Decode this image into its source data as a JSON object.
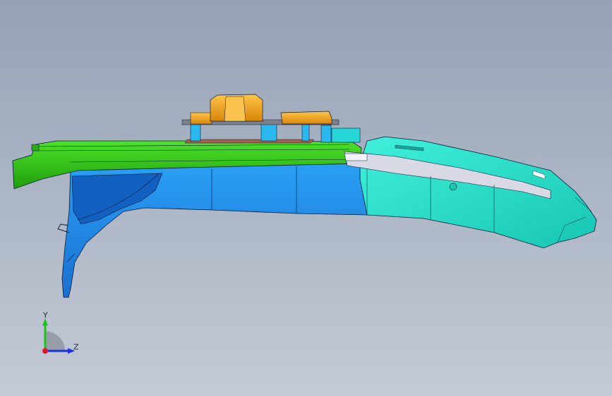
{
  "viewport": {
    "background_top": "#95a2b4",
    "background_bottom": "#c4cad6"
  },
  "model": {
    "colors": {
      "green_panel": "#2ecb12",
      "blue_body": "#1f86e6",
      "cyan_cover": "#27e8cf",
      "orange_blocks": "#f5a516",
      "edge": "#0b1a3a"
    }
  },
  "triad": {
    "y_label": "Y",
    "z_label": "Z",
    "x_color": "#e0142a",
    "y_color": "#1bc21b",
    "z_color": "#1a2fe0"
  }
}
